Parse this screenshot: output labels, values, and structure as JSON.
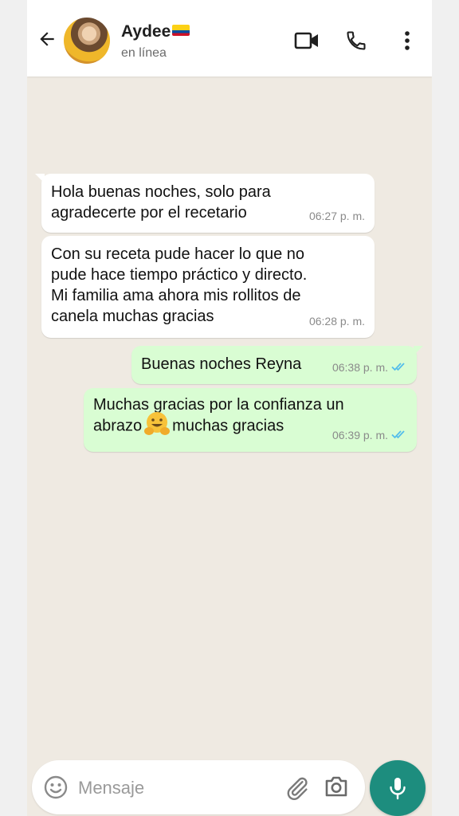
{
  "header": {
    "contact_name": "Aydee",
    "status": "en línea",
    "flag_icon": "ecuador-flag-icon",
    "icons": [
      "back-arrow-icon",
      "video-call-icon",
      "phone-icon",
      "more-vert-icon"
    ]
  },
  "messages": [
    {
      "direction": "incoming",
      "text": "Hola buenas noches, solo para\nagradecerte por el recetario",
      "time": "06:27 p. m."
    },
    {
      "direction": "incoming",
      "text": "Con su receta pude hacer lo que no\npude hace tiempo práctico y directo.\nMi familia ama ahora mis rollitos de\ncanela muchas gracias",
      "time": "06:28 p. m."
    },
    {
      "direction": "outgoing",
      "text": "Buenas noches Reyna",
      "time": "06:38 p. m.",
      "status_icon": "double-check-read-icon"
    },
    {
      "direction": "outgoing",
      "text_line1": "Muchas gracias por la confianza un",
      "text_before_emoji": "abrazo",
      "emoji": "hugging-face-emoji",
      "text_after_emoji": "muchas gracias",
      "time": "06:39 p. m.",
      "status_icon": "double-check-read-icon"
    }
  ],
  "composer": {
    "placeholder": "Mensaje",
    "icons": [
      "emoji-icon",
      "attach-icon",
      "camera-icon",
      "mic-icon"
    ]
  },
  "colors": {
    "chat_background": "#efeae2",
    "incoming_bubble": "#ffffff",
    "outgoing_bubble": "#d9fdd3",
    "accent": "#1d8d7e",
    "read_check": "#53bdeb"
  }
}
